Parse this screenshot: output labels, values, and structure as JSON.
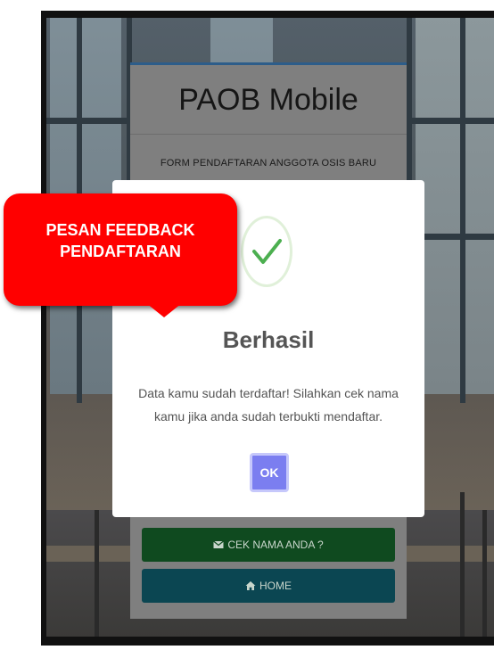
{
  "app": {
    "title": "PAOB Mobile",
    "form_subtitle": "FORM PENDAFTARAN ANGGOTA OSIS BARU"
  },
  "modal": {
    "icon": "check-icon",
    "title": "Berhasil",
    "message": "Data kamu sudah terdaftar! Silahkan cek nama kamu jika anda sudah terbukti mendaftar.",
    "ok_label": "OK"
  },
  "buttons": {
    "cek_label": "CEK NAMA ANDA ?",
    "cek_icon": "envelope-icon",
    "home_label": "HOME",
    "home_icon": "home-icon"
  },
  "callout": {
    "text": "PESAN FEEDBACK\nPENDAFTARAN"
  },
  "colors": {
    "accent": "#7b7ef0",
    "success": "#4caf50",
    "callout": "#ff0000"
  }
}
